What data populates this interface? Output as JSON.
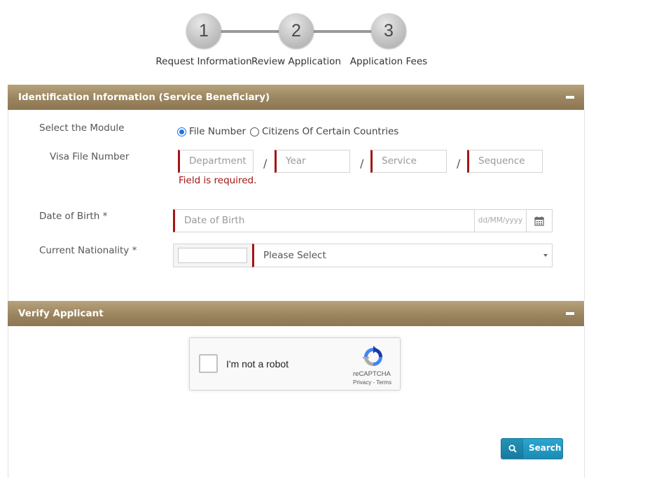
{
  "stepper": {
    "steps": [
      {
        "number": "1",
        "label": "Request Information"
      },
      {
        "number": "2",
        "label": "Review Application"
      },
      {
        "number": "3",
        "label": "Application Fees"
      }
    ]
  },
  "identification_panel": {
    "title": "Identification Information (Service Beneficiary)",
    "module_label": "Select the Module",
    "module_options": [
      {
        "label": "File Number",
        "checked": true
      },
      {
        "label": "Citizens Of Certain Countries",
        "checked": false
      }
    ],
    "visa_file_label": "Visa File Number",
    "visa_fields": {
      "department_placeholder": "Department",
      "year_placeholder": "Year",
      "service_placeholder": "Service",
      "sequence_placeholder": "Sequence",
      "separator": "/"
    },
    "error_text": "Field is required.",
    "dob_label": "Date of Birth *",
    "dob_placeholder": "Date of Birth",
    "dob_format_hint": "dd/MM/yyyy",
    "nationality_label": "Current Nationality *",
    "nationality_selected": "Please Select"
  },
  "verify_panel": {
    "title": "Verify Applicant",
    "recaptcha": {
      "checkbox_label": "I'm not a robot",
      "brand": "reCAPTCHA",
      "links": "Privacy - Terms"
    }
  },
  "actions": {
    "search_label": "Search"
  },
  "colors": {
    "panel_header": "#9b8560",
    "required_marker": "#a31515",
    "button_primary": "#1b8cb6",
    "radio_checked": "#1a73e8"
  }
}
